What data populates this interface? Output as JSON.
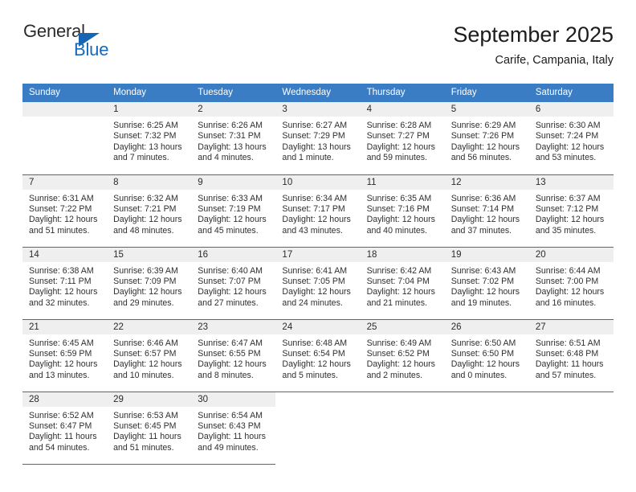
{
  "brand": {
    "line1": "General",
    "line2": "Blue",
    "triangle_color": "#1565b4",
    "blue_text_color": "#1769b8"
  },
  "header": {
    "title": "September 2025",
    "subtitle": "Carife, Campania, Italy"
  },
  "theme": {
    "header_blue": "#3b7dc4",
    "row_divider_blue": "#2f6fb5",
    "daynum_band": "#efeff0"
  },
  "weekday_headers": [
    "Sunday",
    "Monday",
    "Tuesday",
    "Wednesday",
    "Thursday",
    "Friday",
    "Saturday"
  ],
  "weeks": [
    [
      {
        "day": "",
        "sunrise": "",
        "sunset": "",
        "daylight": "",
        "daylight2": ""
      },
      {
        "day": "1",
        "sunrise": "Sunrise: 6:25 AM",
        "sunset": "Sunset: 7:32 PM",
        "daylight": "Daylight: 13 hours",
        "daylight2": "and 7 minutes."
      },
      {
        "day": "2",
        "sunrise": "Sunrise: 6:26 AM",
        "sunset": "Sunset: 7:31 PM",
        "daylight": "Daylight: 13 hours",
        "daylight2": "and 4 minutes."
      },
      {
        "day": "3",
        "sunrise": "Sunrise: 6:27 AM",
        "sunset": "Sunset: 7:29 PM",
        "daylight": "Daylight: 13 hours",
        "daylight2": "and 1 minute."
      },
      {
        "day": "4",
        "sunrise": "Sunrise: 6:28 AM",
        "sunset": "Sunset: 7:27 PM",
        "daylight": "Daylight: 12 hours",
        "daylight2": "and 59 minutes."
      },
      {
        "day": "5",
        "sunrise": "Sunrise: 6:29 AM",
        "sunset": "Sunset: 7:26 PM",
        "daylight": "Daylight: 12 hours",
        "daylight2": "and 56 minutes."
      },
      {
        "day": "6",
        "sunrise": "Sunrise: 6:30 AM",
        "sunset": "Sunset: 7:24 PM",
        "daylight": "Daylight: 12 hours",
        "daylight2": "and 53 minutes."
      }
    ],
    [
      {
        "day": "7",
        "sunrise": "Sunrise: 6:31 AM",
        "sunset": "Sunset: 7:22 PM",
        "daylight": "Daylight: 12 hours",
        "daylight2": "and 51 minutes."
      },
      {
        "day": "8",
        "sunrise": "Sunrise: 6:32 AM",
        "sunset": "Sunset: 7:21 PM",
        "daylight": "Daylight: 12 hours",
        "daylight2": "and 48 minutes."
      },
      {
        "day": "9",
        "sunrise": "Sunrise: 6:33 AM",
        "sunset": "Sunset: 7:19 PM",
        "daylight": "Daylight: 12 hours",
        "daylight2": "and 45 minutes."
      },
      {
        "day": "10",
        "sunrise": "Sunrise: 6:34 AM",
        "sunset": "Sunset: 7:17 PM",
        "daylight": "Daylight: 12 hours",
        "daylight2": "and 43 minutes."
      },
      {
        "day": "11",
        "sunrise": "Sunrise: 6:35 AM",
        "sunset": "Sunset: 7:16 PM",
        "daylight": "Daylight: 12 hours",
        "daylight2": "and 40 minutes."
      },
      {
        "day": "12",
        "sunrise": "Sunrise: 6:36 AM",
        "sunset": "Sunset: 7:14 PM",
        "daylight": "Daylight: 12 hours",
        "daylight2": "and 37 minutes."
      },
      {
        "day": "13",
        "sunrise": "Sunrise: 6:37 AM",
        "sunset": "Sunset: 7:12 PM",
        "daylight": "Daylight: 12 hours",
        "daylight2": "and 35 minutes."
      }
    ],
    [
      {
        "day": "14",
        "sunrise": "Sunrise: 6:38 AM",
        "sunset": "Sunset: 7:11 PM",
        "daylight": "Daylight: 12 hours",
        "daylight2": "and 32 minutes."
      },
      {
        "day": "15",
        "sunrise": "Sunrise: 6:39 AM",
        "sunset": "Sunset: 7:09 PM",
        "daylight": "Daylight: 12 hours",
        "daylight2": "and 29 minutes."
      },
      {
        "day": "16",
        "sunrise": "Sunrise: 6:40 AM",
        "sunset": "Sunset: 7:07 PM",
        "daylight": "Daylight: 12 hours",
        "daylight2": "and 27 minutes."
      },
      {
        "day": "17",
        "sunrise": "Sunrise: 6:41 AM",
        "sunset": "Sunset: 7:05 PM",
        "daylight": "Daylight: 12 hours",
        "daylight2": "and 24 minutes."
      },
      {
        "day": "18",
        "sunrise": "Sunrise: 6:42 AM",
        "sunset": "Sunset: 7:04 PM",
        "daylight": "Daylight: 12 hours",
        "daylight2": "and 21 minutes."
      },
      {
        "day": "19",
        "sunrise": "Sunrise: 6:43 AM",
        "sunset": "Sunset: 7:02 PM",
        "daylight": "Daylight: 12 hours",
        "daylight2": "and 19 minutes."
      },
      {
        "day": "20",
        "sunrise": "Sunrise: 6:44 AM",
        "sunset": "Sunset: 7:00 PM",
        "daylight": "Daylight: 12 hours",
        "daylight2": "and 16 minutes."
      }
    ],
    [
      {
        "day": "21",
        "sunrise": "Sunrise: 6:45 AM",
        "sunset": "Sunset: 6:59 PM",
        "daylight": "Daylight: 12 hours",
        "daylight2": "and 13 minutes."
      },
      {
        "day": "22",
        "sunrise": "Sunrise: 6:46 AM",
        "sunset": "Sunset: 6:57 PM",
        "daylight": "Daylight: 12 hours",
        "daylight2": "and 10 minutes."
      },
      {
        "day": "23",
        "sunrise": "Sunrise: 6:47 AM",
        "sunset": "Sunset: 6:55 PM",
        "daylight": "Daylight: 12 hours",
        "daylight2": "and 8 minutes."
      },
      {
        "day": "24",
        "sunrise": "Sunrise: 6:48 AM",
        "sunset": "Sunset: 6:54 PM",
        "daylight": "Daylight: 12 hours",
        "daylight2": "and 5 minutes."
      },
      {
        "day": "25",
        "sunrise": "Sunrise: 6:49 AM",
        "sunset": "Sunset: 6:52 PM",
        "daylight": "Daylight: 12 hours",
        "daylight2": "and 2 minutes."
      },
      {
        "day": "26",
        "sunrise": "Sunrise: 6:50 AM",
        "sunset": "Sunset: 6:50 PM",
        "daylight": "Daylight: 12 hours",
        "daylight2": "and 0 minutes."
      },
      {
        "day": "27",
        "sunrise": "Sunrise: 6:51 AM",
        "sunset": "Sunset: 6:48 PM",
        "daylight": "Daylight: 11 hours",
        "daylight2": "and 57 minutes."
      }
    ],
    [
      {
        "day": "28",
        "sunrise": "Sunrise: 6:52 AM",
        "sunset": "Sunset: 6:47 PM",
        "daylight": "Daylight: 11 hours",
        "daylight2": "and 54 minutes."
      },
      {
        "day": "29",
        "sunrise": "Sunrise: 6:53 AM",
        "sunset": "Sunset: 6:45 PM",
        "daylight": "Daylight: 11 hours",
        "daylight2": "and 51 minutes."
      },
      {
        "day": "30",
        "sunrise": "Sunrise: 6:54 AM",
        "sunset": "Sunset: 6:43 PM",
        "daylight": "Daylight: 11 hours",
        "daylight2": "and 49 minutes."
      },
      {
        "day": "",
        "sunrise": "",
        "sunset": "",
        "daylight": "",
        "daylight2": ""
      },
      {
        "day": "",
        "sunrise": "",
        "sunset": "",
        "daylight": "",
        "daylight2": ""
      },
      {
        "day": "",
        "sunrise": "",
        "sunset": "",
        "daylight": "",
        "daylight2": ""
      },
      {
        "day": "",
        "sunrise": "",
        "sunset": "",
        "daylight": "",
        "daylight2": ""
      }
    ]
  ]
}
